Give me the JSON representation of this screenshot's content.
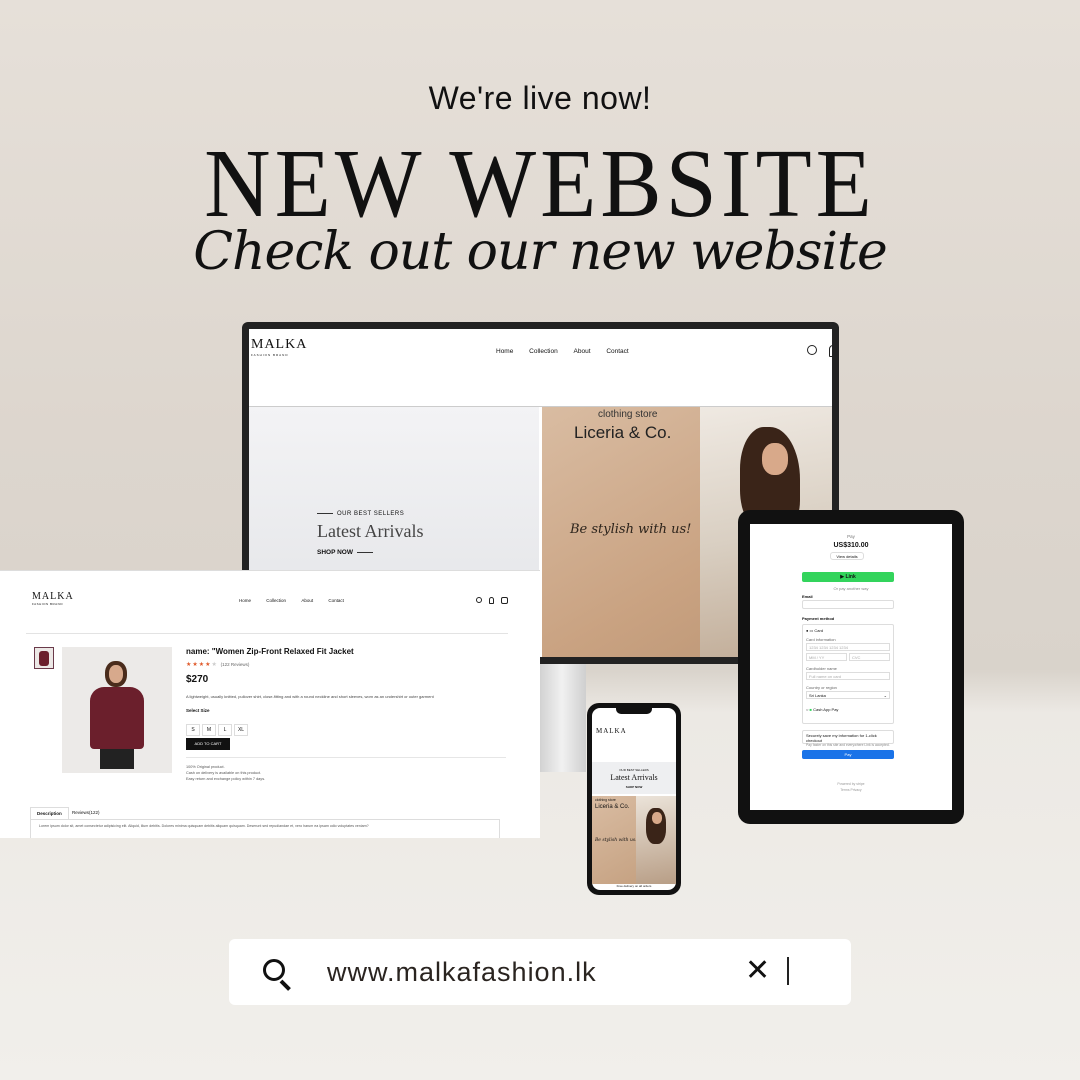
{
  "headline": {
    "tagline": "We're live now!",
    "title": "NEW WEBSITE",
    "script": "Check out our new website"
  },
  "desktop": {
    "brand": "MALKA",
    "brand_sub": "FASHION BRAND",
    "nav": [
      "Home",
      "Collection",
      "About",
      "Contact"
    ],
    "hero_kicker": "OUR BEST SELLERS",
    "hero_title": "Latest Arrivals",
    "hero_cta": "SHOP NOW",
    "banner_small": "clothing store",
    "banner_title": "Liceria & Co.",
    "banner_script": "Be stylish with us!"
  },
  "product_page": {
    "brand": "MALKA",
    "brand_sub": "FASHION BRAND",
    "nav": [
      "Home",
      "Collection",
      "About",
      "Contact"
    ],
    "name": "name: \"Women Zip-Front Relaxed Fit Jacket",
    "reviews": "(122 Reviews)",
    "stars": 4,
    "price": "$270",
    "desc": "A lightweight, usually knitted, pullover shirt, close-fitting and with a round neckline and short sleeves, worn as an undershirt or outer garment",
    "size_label": "Select Size",
    "sizes": [
      "S",
      "M",
      "L",
      "XL"
    ],
    "cta": "ADD TO CART",
    "notes": [
      "100% Original product.",
      "Cash on delivery is available on this product.",
      "Easy return and exchange policy within 7 days."
    ],
    "tabs": [
      "Description",
      "Reviews(122)"
    ],
    "tab_text": "Lorem ipsum dolor sit, amet consectetur adipisicing elit. Aliquid, illum debitis. Dolores minima quisquam debitis aliquam quisquam. Deserunt sed repudiandae et, vero harum ea ipsam odio voluptates veniam?"
  },
  "checkout": {
    "top": "Pay",
    "amount": "US$310.00",
    "details": "View details",
    "link": "Link",
    "alt": "Or pay another way",
    "email": "Email",
    "payment": "Payment method",
    "card": "Card",
    "card_info": "Card information",
    "card_ph": "1234 1234 1234 1234",
    "mmyy": "MM / YY",
    "cvc": "CVC",
    "holder": "Cardholder name",
    "holder_ph": "Full name on card",
    "country": "Country or region",
    "country_val": "Sri Lanka",
    "cashapp": "Cash App Pay",
    "save": "Securely save my information for 1-click checkout",
    "save_sub": "Pay faster on this site and everywhere Link is accepted.",
    "pay": "Pay",
    "powered": "Powered by stripe",
    "footer": "Terms   Privacy"
  },
  "phone": {
    "brand": "MALKA",
    "kicker": "OUR BEST SELLERS",
    "title": "Latest Arrivals",
    "cta": "SHOP NOW",
    "small": "clothing store",
    "banner": "Liceria & Co.",
    "script": "Be stylish with us!",
    "bottom": "Free delivery on all orders"
  },
  "search": {
    "url": "www.malkafashion.lk"
  },
  "colors": {
    "accent": "#2a2420",
    "stripe_green": "#33d45c",
    "stripe_blue": "#1a73e8",
    "jacket": "#6b1f2c",
    "star": "#e05a2b"
  }
}
